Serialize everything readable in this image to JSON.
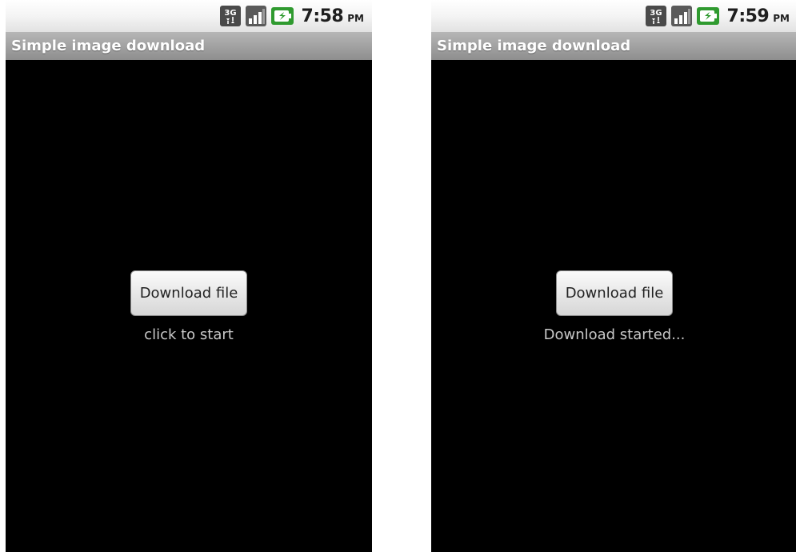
{
  "screens": [
    {
      "status_bar": {
        "network_label": "3G",
        "time": "7:58",
        "ampm": "PM",
        "icons": [
          "3g-data-icon",
          "signal-strength-icon",
          "battery-charging-icon"
        ]
      },
      "app_title": "Simple image download",
      "button_label": "Download file",
      "status_text": "click to start"
    },
    {
      "status_bar": {
        "network_label": "3G",
        "time": "7:59",
        "ampm": "PM",
        "icons": [
          "3g-data-icon",
          "signal-strength-icon",
          "battery-charging-icon"
        ]
      },
      "app_title": "Simple image download",
      "button_label": "Download file",
      "status_text": "Download started..."
    }
  ],
  "colors": {
    "screen_background": "#000000",
    "title_bar": "#a0a0a0",
    "battery_green": "#2f9a2f",
    "signal_dark": "#333333"
  }
}
